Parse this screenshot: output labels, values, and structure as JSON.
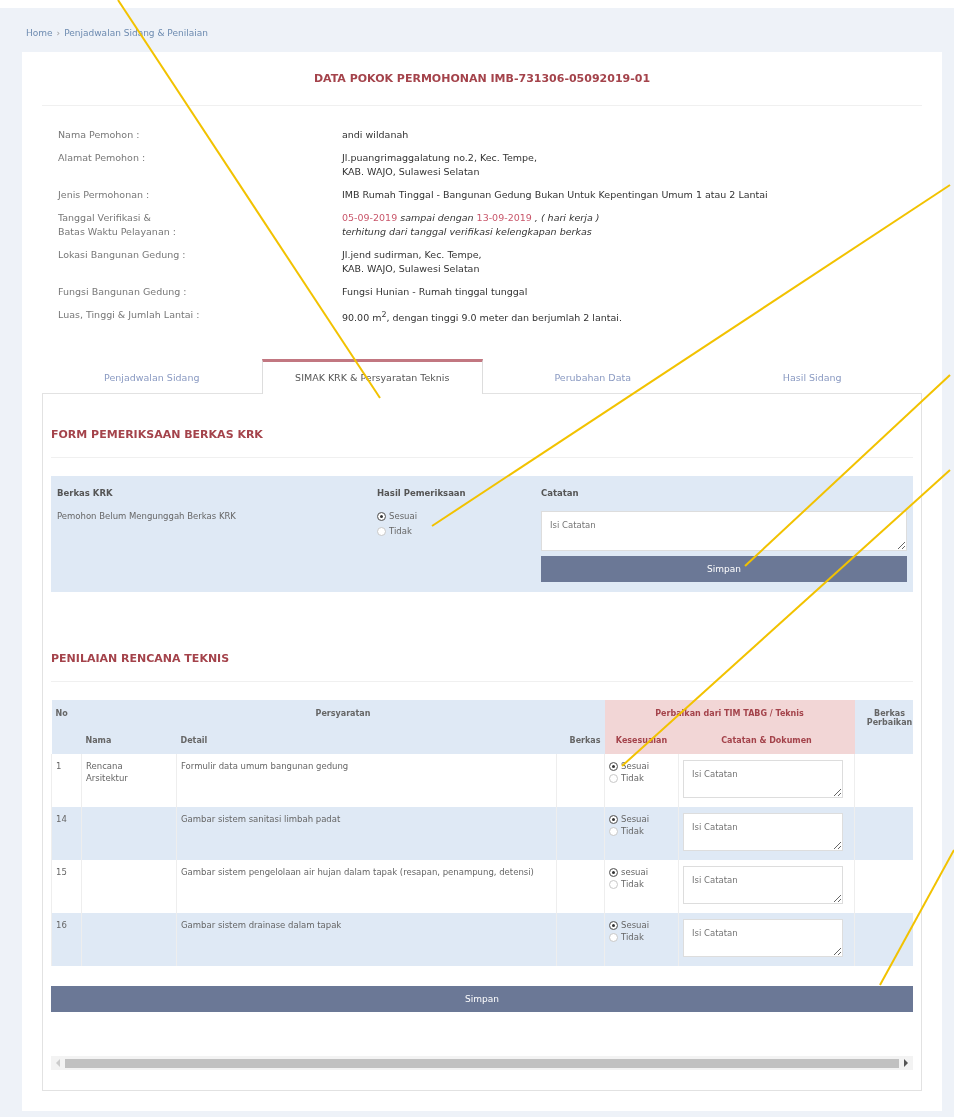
{
  "breadcrumb": [
    "Home",
    "Penjadwalan Sidang & Penilaian"
  ],
  "breadcrumb_separator": "›",
  "title": "DATA POKOK PERMOHONAN IMB-731306-05092019-01",
  "info": [
    {
      "label": [
        "Nama Pemohon :"
      ],
      "lines": [
        [
          {
            "kind": "plain",
            "text": "andi wildanah"
          }
        ]
      ]
    },
    {
      "label": [
        "Alamat Pemohon :"
      ],
      "lines": [
        [
          {
            "kind": "plain",
            "text": "Jl.puangrimaggalatung no.2, Kec. Tempe,"
          }
        ],
        [
          {
            "kind": "plain",
            "text": "KAB. WAJO, Sulawesi Selatan"
          }
        ]
      ]
    },
    {
      "label": [
        "Jenis Permohonan :"
      ],
      "lines": [
        [
          {
            "kind": "plain",
            "text": "IMB Rumah Tinggal - Bangunan Gedung Bukan Untuk Kepentingan Umum 1 atau 2 Lantai"
          }
        ]
      ]
    },
    {
      "label": [
        "Tanggal Verifikasi &",
        "Batas Waktu Pelayanan :"
      ],
      "lines": [
        [
          {
            "kind": "date",
            "text": "05-09-2019"
          },
          {
            "kind": "italic",
            "text": "sampai dengan"
          },
          {
            "kind": "date",
            "text": "13-09-2019"
          },
          {
            "kind": "italic",
            "text": ", ( hari kerja )"
          }
        ],
        [
          {
            "kind": "italic",
            "text": "terhitung dari tanggal verifikasi kelengkapan berkas"
          }
        ]
      ]
    },
    {
      "label": [
        "Lokasi Bangunan Gedung :"
      ],
      "lines": [
        [
          {
            "kind": "plain",
            "text": "Jl.jend sudirman, Kec. Tempe,"
          }
        ],
        [
          {
            "kind": "plain",
            "text": "KAB. WAJO, Sulawesi Selatan"
          }
        ]
      ]
    },
    {
      "label": [
        "Fungsi Bangunan Gedung :"
      ],
      "lines": [
        [
          {
            "kind": "plain",
            "text": "Fungsi Hunian - Rumah tinggal tunggal"
          }
        ]
      ]
    },
    {
      "label": [
        "Luas, Tinggi & Jumlah Lantai :"
      ],
      "lines": [
        [
          {
            "kind": "plain",
            "text": "90.00 m$^{2}$, dengan tinggi 9.0 meter dan berjumlah 2 lantai."
          }
        ]
      ]
    }
  ],
  "tabs": [
    {
      "label": "Penjadwalan Sidang",
      "selected": false
    },
    {
      "label": "SIMAK KRK & Persyaratan Teknis",
      "selected": true
    },
    {
      "label": "Perubahan Data",
      "selected": false
    },
    {
      "label": "Hasil Sidang",
      "selected": false
    }
  ],
  "krk": {
    "heading": "FORM PEMERIKSAAN BERKAS KRK",
    "columns": [
      "Berkas KRK",
      "Hasil Pemeriksaan",
      "Catatan"
    ],
    "berkas": "Pemohon Belum Mengunggah Berkas KRK",
    "options": [
      {
        "label": "Sesuai",
        "selected": true
      },
      {
        "label": "Tidak",
        "selected": false
      }
    ],
    "placeholder": "Isi Catatan",
    "button": "Simpan"
  },
  "penilaian": {
    "heading": "PENILAIAN RENCANA TEKNIS",
    "head": {
      "no": "No",
      "persyaratan": "Persyaratan",
      "perbaikan": "Perbaikan dari TIM TABG / Teknis",
      "berkas_perbaikan": "Berkas Perbaikan",
      "nama": "Nama",
      "detail": "Detail",
      "berkas": "Berkas",
      "kesesuaian": "Kesesuaian",
      "catatan": "Catatan & Dokumen"
    },
    "rows": [
      {
        "no": "1",
        "nama": [
          "Rencana",
          "Arsitektur"
        ],
        "detail": "Formulir data umum bangunan gedung",
        "options": [
          {
            "label": "Sesuai",
            "selected": true
          },
          {
            "label": "Tidak",
            "selected": false
          }
        ],
        "placeholder": "Isi Catatan"
      },
      {
        "no": "14",
        "nama": [],
        "detail": "Gambar sistem sanitasi limbah padat",
        "options": [
          {
            "label": "Sesuai",
            "selected": true
          },
          {
            "label": "Tidak",
            "selected": false
          }
        ],
        "placeholder": "Isi Catatan"
      },
      {
        "no": "15",
        "nama": [],
        "detail": "Gambar sistem pengelolaan air hujan dalam tapak (resapan, penampung, detensi)",
        "options": [
          {
            "label": "sesuai",
            "selected": true
          },
          {
            "label": "Tidak",
            "selected": false
          }
        ],
        "placeholder": "Isi Catatan"
      },
      {
        "no": "16",
        "nama": [],
        "detail": "Gambar sistem drainase dalam tapak",
        "options": [
          {
            "label": "Sesuai",
            "selected": true
          },
          {
            "label": "Tidak",
            "selected": false
          }
        ],
        "placeholder": "Isi Catatan"
      }
    ],
    "button": "Simpan"
  }
}
